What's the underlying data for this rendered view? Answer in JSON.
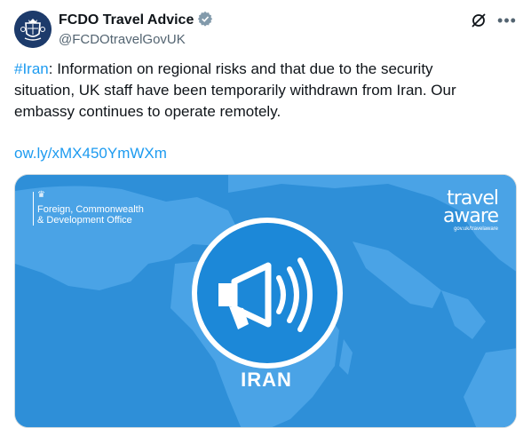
{
  "tweet": {
    "display_name": "FCDO Travel Advice",
    "handle": "@FCDOtravelGovUK",
    "hashtag": "#Iran",
    "body": ": Information on regional risks and that due to the security situation, UK staff have been temporarily withdrawn from Iran. Our embassy continues to operate remotely.",
    "link": "ow.ly/xMX450YmWXm"
  },
  "icons": {
    "avatar": "royal-crest-avatar",
    "verified": "verified-badge-icon",
    "grok": "grok-icon",
    "more": "more-icon",
    "megaphone": "megaphone-icon"
  },
  "media": {
    "org_line1": "Foreign, Commonwealth",
    "org_line2": "& Development Office",
    "brand_line1": "travel",
    "brand_line2": "aware",
    "brand_url": "gov.uk/travelaware",
    "country": "IRAN"
  },
  "colors": {
    "link": "#1d9bf0",
    "media_bg": "#2e8fd8",
    "text": "#0f1419",
    "secondary": "#536471"
  }
}
